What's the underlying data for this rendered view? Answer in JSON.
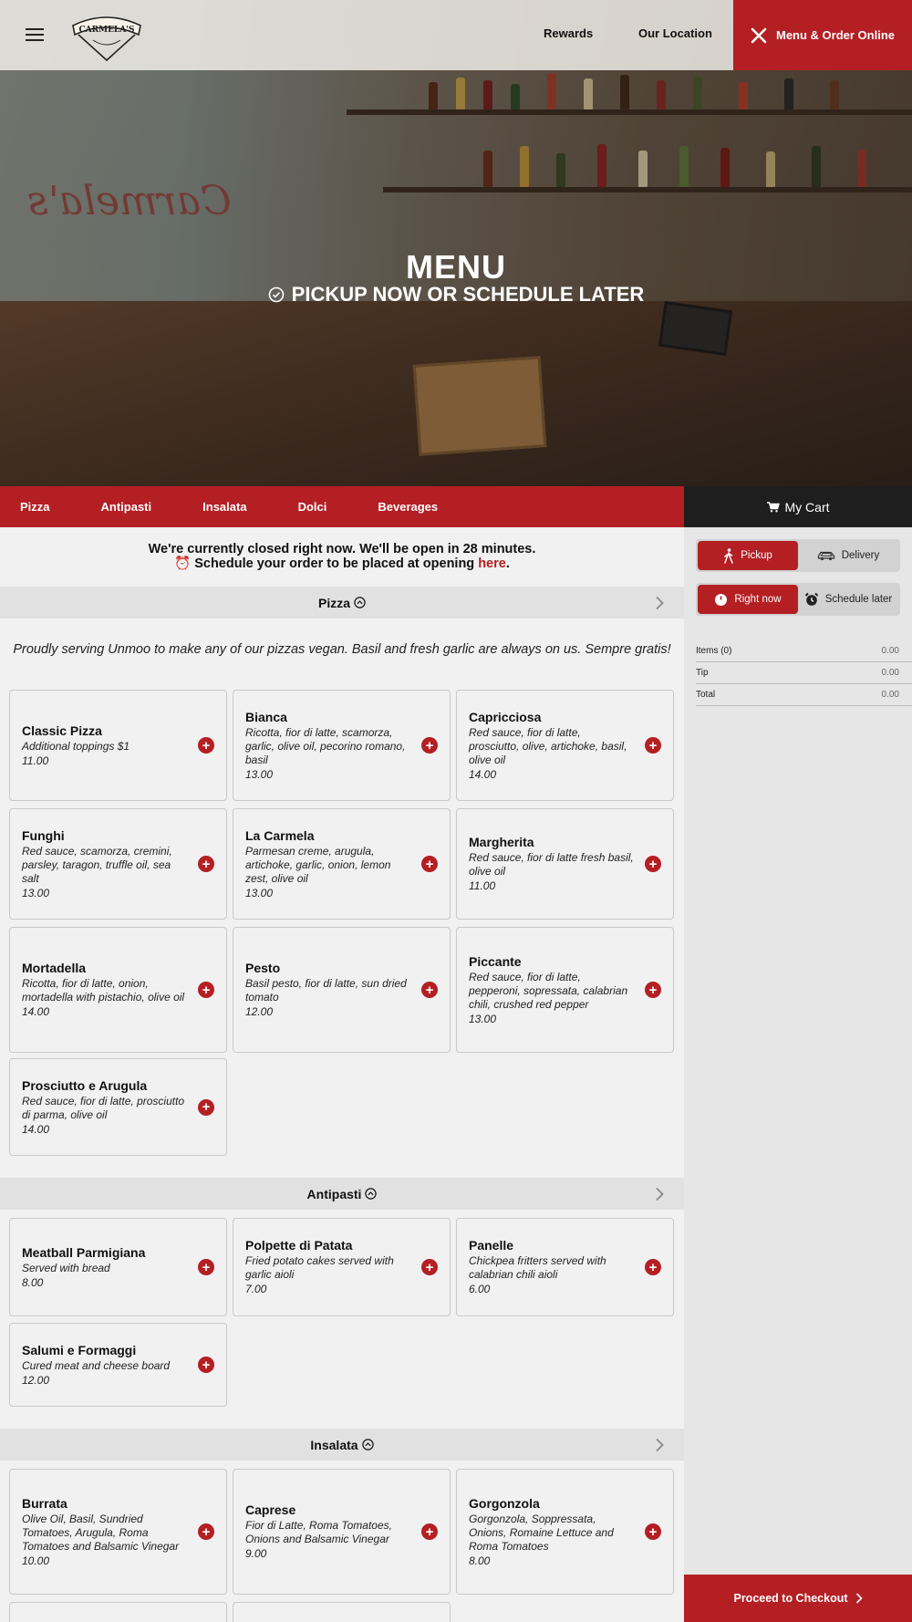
{
  "header": {
    "logo_text": "CARMELA'S",
    "nav": {
      "rewards": "Rewards",
      "location": "Our Location"
    },
    "order_button": "Menu & Order Online"
  },
  "hero": {
    "title": "MENU",
    "subtitle": "PICKUP NOW OR SCHEDULE LATER"
  },
  "categories": [
    "Pizza",
    "Antipasti",
    "Insalata",
    "Dolci",
    "Beverages"
  ],
  "cart_title": "My Cart",
  "notice": {
    "line1": "We're currently closed right now. We'll be open in 28 minutes.",
    "line2_prefix": "Schedule your order to be placed at opening ",
    "line2_link": "here",
    "line2_suffix": "."
  },
  "sections": {
    "pizza": {
      "title": "Pizza",
      "intro": "Proudly serving Unmoo to make any of our pizzas vegan. Basil and fresh garlic are always on us. Sempre gratis!",
      "items": [
        {
          "name": "Classic Pizza",
          "desc": "Additional toppings $1",
          "price": "11.00"
        },
        {
          "name": "Bianca",
          "desc": "Ricotta, fior di latte, scamorza, garlic, olive oil, pecorino romano, basil",
          "price": "13.00"
        },
        {
          "name": "Capricciosa",
          "desc": "Red sauce, fior di latte, prosciutto, olive, artichoke, basil, olive oil",
          "price": "14.00"
        },
        {
          "name": "Funghi",
          "desc": "Red sauce, scamorza, cremini, parsley, taragon, truffle oil, sea salt",
          "price": "13.00"
        },
        {
          "name": "La Carmela",
          "desc": "Parmesan creme, arugula, artichoke, garlic, onion, lemon zest, olive oil",
          "price": "13.00"
        },
        {
          "name": "Margherita",
          "desc": "Red sauce, fior di latte fresh basil, olive oil",
          "price": "11.00"
        },
        {
          "name": "Mortadella",
          "desc": "Ricotta, fior di latte, onion, mortadella with pistachio, olive oil",
          "price": "14.00"
        },
        {
          "name": "Pesto",
          "desc": "Basil pesto, fior di latte, sun dried tomato",
          "price": "12.00"
        },
        {
          "name": "Piccante",
          "desc": "Red sauce, fior di latte, pepperoni, sopressata, calabrian chili, crushed red pepper",
          "price": "13.00"
        },
        {
          "name": "Prosciutto e Arugula",
          "desc": "Red sauce, fior di latte, prosciutto di parma, olive oil",
          "price": "14.00"
        }
      ]
    },
    "antipasti": {
      "title": "Antipasti",
      "items": [
        {
          "name": "Meatball Parmigiana",
          "desc": "Served with bread",
          "price": "8.00"
        },
        {
          "name": "Polpette di Patata",
          "desc": "Fried potato cakes served with garlic aioli",
          "price": "7.00"
        },
        {
          "name": "Panelle",
          "desc": "Chickpea fritters served with calabrian chili aioli",
          "price": "6.00"
        },
        {
          "name": "Salumi e Formaggi",
          "desc": "Cured meat and cheese board",
          "price": "12.00"
        }
      ]
    },
    "insalata": {
      "title": "Insalata",
      "items": [
        {
          "name": "Burrata",
          "desc": "Olive Oil, Basil, Sundried Tomatoes, Arugula, Roma Tomatoes and Balsamic Vinegar",
          "price": "10.00"
        },
        {
          "name": "Caprese",
          "desc": "Fior di Latte, Roma Tomatoes, Onions and Balsamic Vinegar",
          "price": "9.00"
        },
        {
          "name": "Gorgonzola",
          "desc": "Gorgonzola, Soppressata, Onions, Romaine Lettuce and Roma Tomatoes",
          "price": "8.00"
        }
      ]
    }
  },
  "cart": {
    "mode": {
      "pickup": "Pickup",
      "delivery": "Delivery"
    },
    "timing": {
      "now": "Right now",
      "later": "Schedule later"
    },
    "summary": [
      {
        "label": "Items (0)",
        "value": "0.00"
      },
      {
        "label": "Tip",
        "value": "0.00"
      },
      {
        "label": "Total",
        "value": "0.00"
      }
    ],
    "checkout": "Proceed to Checkout"
  },
  "colors": {
    "brand_red": "#b41f24",
    "dark": "#1e1e1e"
  }
}
